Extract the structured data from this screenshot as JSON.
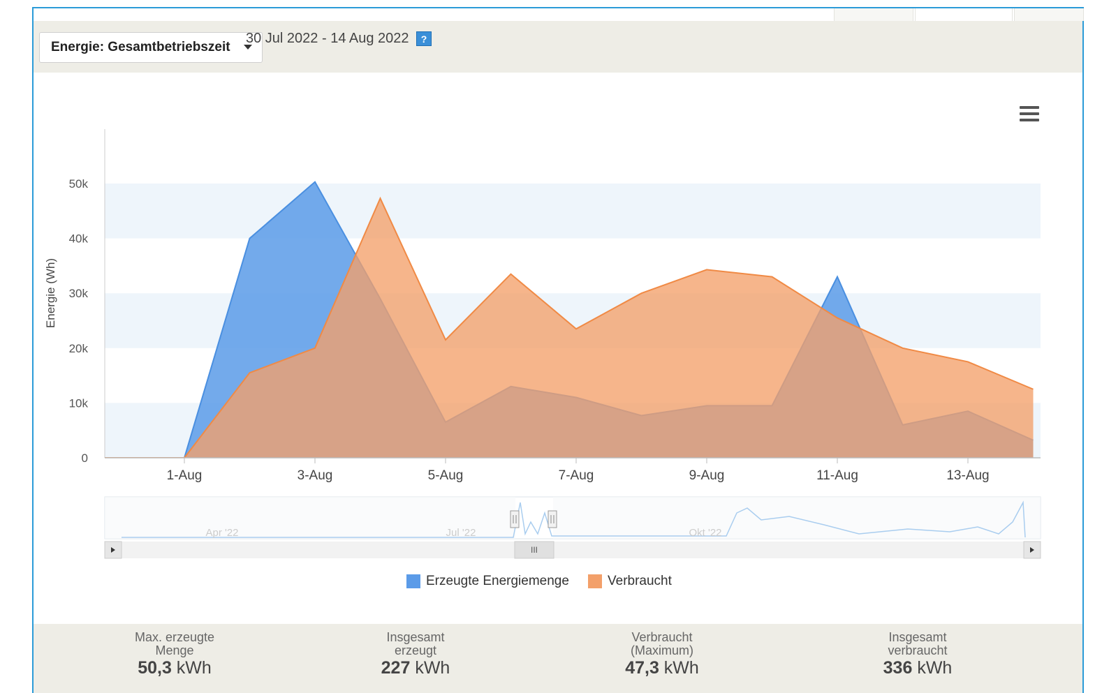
{
  "toolbar": {
    "selector_label": "Energie: Gesamtbetriebszeit",
    "date_range": "30 Jul 2022 - 14 Aug 2022",
    "help_glyph": "?"
  },
  "icons": {
    "menu": "hamburger-menu-icon",
    "help": "help-icon",
    "dropdown": "caret-down-icon",
    "scroll_left": "arrow-left-icon",
    "scroll_right": "arrow-right-icon"
  },
  "navigator": {
    "labels": [
      "Apr '22",
      "Jul '22",
      "Okt '22"
    ],
    "grip": "III"
  },
  "colors": {
    "produced": "#5b9be8",
    "consumed": "#f3a06a",
    "overlap": "#d49a7a",
    "frame": "#2b9bd8",
    "toolbar_bg": "#eeede6"
  },
  "chart_data": {
    "type": "area",
    "title": "",
    "xlabel": "",
    "ylabel": "Energie (Wh)",
    "x": [
      "30-Jul",
      "31-Jul",
      "1-Aug",
      "2-Aug",
      "3-Aug",
      "4-Aug",
      "5-Aug",
      "6-Aug",
      "7-Aug",
      "8-Aug",
      "9-Aug",
      "10-Aug",
      "11-Aug",
      "12-Aug",
      "13-Aug",
      "14-Aug"
    ],
    "x_tick_labels": [
      "1-Aug",
      "3-Aug",
      "5-Aug",
      "7-Aug",
      "9-Aug",
      "11-Aug",
      "13-Aug"
    ],
    "y_tick_labels": [
      "0",
      "10k",
      "20k",
      "30k",
      "40k",
      "50k"
    ],
    "ylim": [
      0,
      60000
    ],
    "grid": "alternating horizontal bands",
    "legend_position": "bottom-center",
    "series": [
      {
        "name": "Erzeugte Energiemenge",
        "color": "#5b9be8",
        "values": [
          0,
          0,
          0,
          40000,
          50300,
          29000,
          6500,
          13000,
          11000,
          7700,
          9500,
          9500,
          33000,
          6000,
          8500,
          3200
        ]
      },
      {
        "name": "Verbraucht",
        "color": "#f3a06a",
        "values": [
          0,
          0,
          0,
          15500,
          20000,
          47300,
          21500,
          33500,
          23500,
          30000,
          34300,
          33000,
          25500,
          20000,
          17500,
          12500
        ]
      }
    ]
  },
  "stats": [
    {
      "label_line1": "Max. erzeugte",
      "label_line2": "Menge",
      "value": "50,3",
      "unit": " kWh"
    },
    {
      "label_line1": "Insgesamt",
      "label_line2": "erzeugt",
      "value": "227",
      "unit": " kWh"
    },
    {
      "label_line1": "Verbraucht",
      "label_line2": "(Maximum)",
      "value": "47,3",
      "unit": " kWh"
    },
    {
      "label_line1": "Insgesamt",
      "label_line2": "verbraucht",
      "value": "336",
      "unit": " kWh"
    }
  ]
}
